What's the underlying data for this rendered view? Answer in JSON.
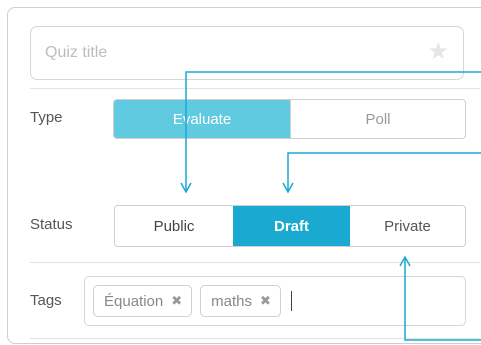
{
  "quiz_title": {
    "placeholder": "Quiz title",
    "value": ""
  },
  "type": {
    "label": "Type",
    "options": [
      "Evaluate",
      "Poll"
    ],
    "selected": "Evaluate"
  },
  "status": {
    "label": "Status",
    "options": [
      "Public",
      "Draft",
      "Private"
    ],
    "selected": "Draft"
  },
  "tags": {
    "label": "Tags",
    "items": [
      "Équation",
      "maths"
    ],
    "remove_glyph": "✖"
  },
  "colors": {
    "type_selected": "#5fcae0",
    "status_selected": "#1aa9d0",
    "annotation_arrow": "#1aa9d0"
  },
  "icons": {
    "favorite": "star-icon",
    "tag_remove": "close-icon"
  }
}
